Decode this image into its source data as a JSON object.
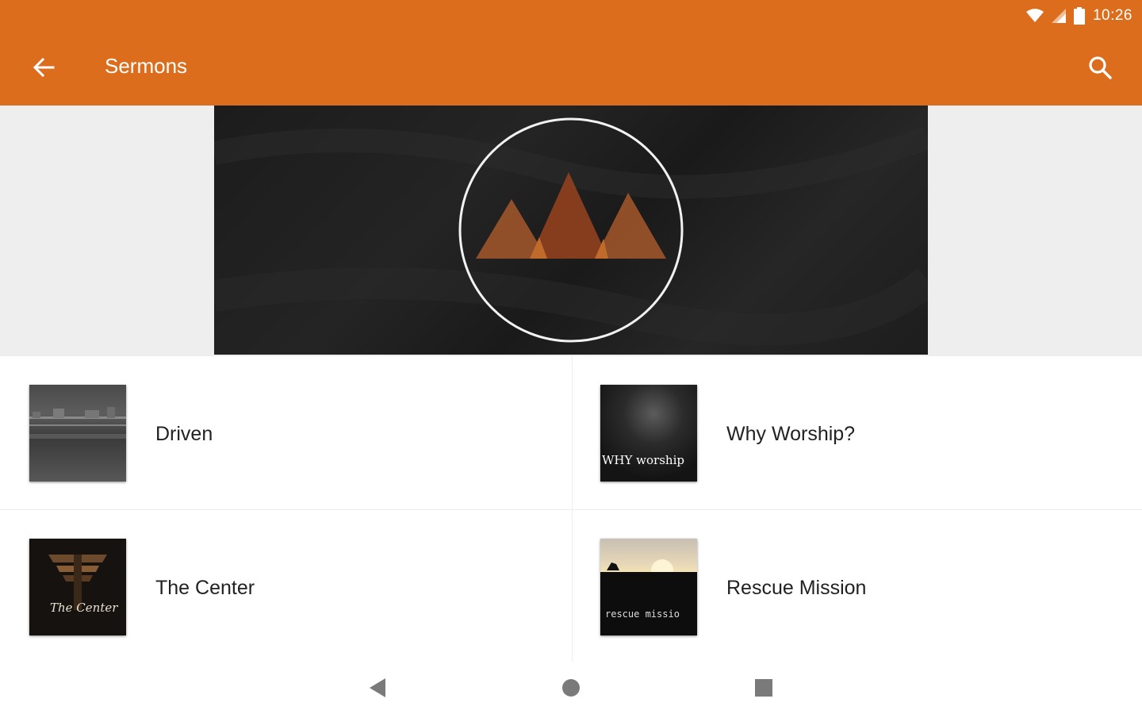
{
  "status_bar": {
    "time": "10:26",
    "icons": [
      "wifi-icon",
      "signal-icon",
      "battery-icon"
    ]
  },
  "toolbar": {
    "title": "Sermons",
    "back_icon": "arrow-left-icon",
    "search_icon": "search-icon"
  },
  "colors": {
    "accent": "#dc6d1c",
    "banner_bg": "#1f1f1f",
    "divider": "#eeeeee"
  },
  "sermons": [
    {
      "title": "Driven"
    },
    {
      "title": "Why Worship?",
      "thumb_text": "WHY worship"
    },
    {
      "title": "The Center",
      "thumb_text": "The Center"
    },
    {
      "title": "Rescue Mission",
      "thumb_text": "rescue missio"
    }
  ],
  "nav_bar": {
    "icons": [
      "back-triangle-icon",
      "home-circle-icon",
      "recents-square-icon"
    ]
  }
}
